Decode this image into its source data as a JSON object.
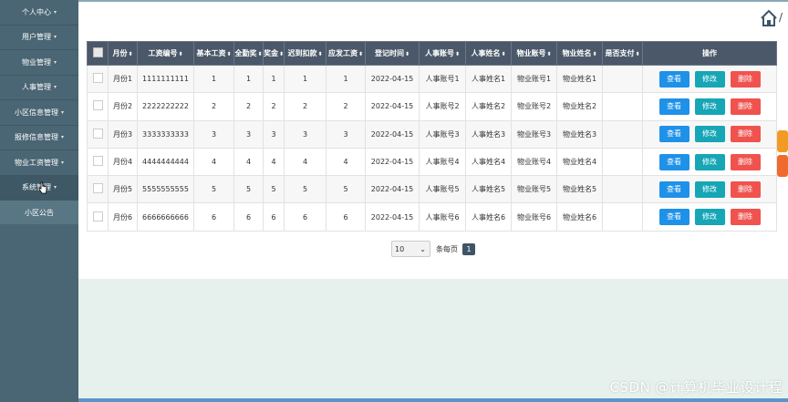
{
  "sidebar": {
    "items": [
      {
        "label": "个人中心"
      },
      {
        "label": "用户管理"
      },
      {
        "label": "物业管理"
      },
      {
        "label": "人事管理"
      },
      {
        "label": "小区信息管理"
      },
      {
        "label": "报修信息管理"
      },
      {
        "label": "物业工资管理"
      },
      {
        "label": "系统管理"
      }
    ],
    "submenu": [
      {
        "label": "小区公告"
      }
    ]
  },
  "table": {
    "headers": [
      "月份",
      "工资编号",
      "基本工资",
      "全勤奖",
      "奖金",
      "迟到扣款",
      "应发工资",
      "登记时间",
      "人事账号",
      "人事姓名",
      "物业账号",
      "物业姓名",
      "是否支付",
      "操作"
    ],
    "rows": [
      [
        "月份1",
        "1111111111",
        "1",
        "1",
        "1",
        "1",
        "1",
        "2022-04-15",
        "人事账号1",
        "人事姓名1",
        "物业账号1",
        "物业姓名1",
        ""
      ],
      [
        "月份2",
        "2222222222",
        "2",
        "2",
        "2",
        "2",
        "2",
        "2022-04-15",
        "人事账号2",
        "人事姓名2",
        "物业账号2",
        "物业姓名2",
        ""
      ],
      [
        "月份3",
        "3333333333",
        "3",
        "3",
        "3",
        "3",
        "3",
        "2022-04-15",
        "人事账号3",
        "人事姓名3",
        "物业账号3",
        "物业姓名3",
        ""
      ],
      [
        "月份4",
        "4444444444",
        "4",
        "4",
        "4",
        "4",
        "4",
        "2022-04-15",
        "人事账号4",
        "人事姓名4",
        "物业账号4",
        "物业姓名4",
        ""
      ],
      [
        "月份5",
        "5555555555",
        "5",
        "5",
        "5",
        "5",
        "5",
        "2022-04-15",
        "人事账号5",
        "人事姓名5",
        "物业账号5",
        "物业姓名5",
        ""
      ],
      [
        "月份6",
        "6666666666",
        "6",
        "6",
        "6",
        "6",
        "6",
        "2022-04-15",
        "人事账号6",
        "人事姓名6",
        "物业账号6",
        "物业姓名6",
        ""
      ]
    ],
    "actions": {
      "view": "查看",
      "edit": "修改",
      "delete": "删除"
    }
  },
  "pagination": {
    "page_size": "10",
    "per_page_label": "条每页",
    "current_page": "1"
  },
  "breadcrumb": {
    "separator": "/"
  },
  "watermark": "CSDN @计算机毕业设计程",
  "icons": {
    "home": "home-icon",
    "sort": "sort-icon",
    "cursor": "hand-cursor-icon"
  },
  "colors": {
    "sidebar": "#4a6573",
    "header": "#4b5869",
    "view": "#1e91e8",
    "edit": "#16a6b6",
    "delete": "#f0524e"
  }
}
